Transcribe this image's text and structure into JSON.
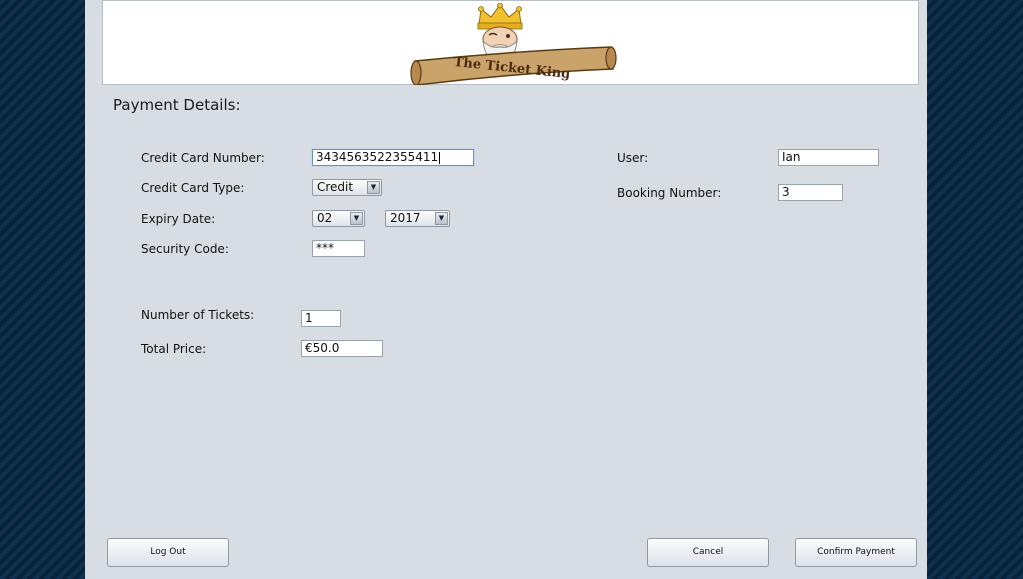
{
  "banner": {
    "logo_text": "The Ticket King"
  },
  "section_title": "Payment Details:",
  "form": {
    "credit_card_number": {
      "label": "Credit Card Number:",
      "value": "3434563522355411"
    },
    "credit_card_type": {
      "label": "Credit Card Type:",
      "value": "Credit"
    },
    "expiry_date": {
      "label": "Expiry Date:",
      "month": "02",
      "year": "2017"
    },
    "security_code": {
      "label": "Security Code:",
      "value": "***"
    },
    "number_of_tickets": {
      "label": "Number of Tickets:",
      "value": "1"
    },
    "total_price": {
      "label": "Total Price:",
      "value": "€50.0"
    },
    "user": {
      "label": "User:",
      "value": "Ian"
    },
    "booking_number": {
      "label": "Booking Number:",
      "value": "3"
    }
  },
  "buttons": {
    "log_out": "Log Out",
    "cancel": "Cancel",
    "confirm_payment": "Confirm Payment"
  },
  "colors": {
    "background": "#0d2a44",
    "window": "#d8dde3",
    "crown": "#f2c12e",
    "scroll": "#c9a36a"
  }
}
